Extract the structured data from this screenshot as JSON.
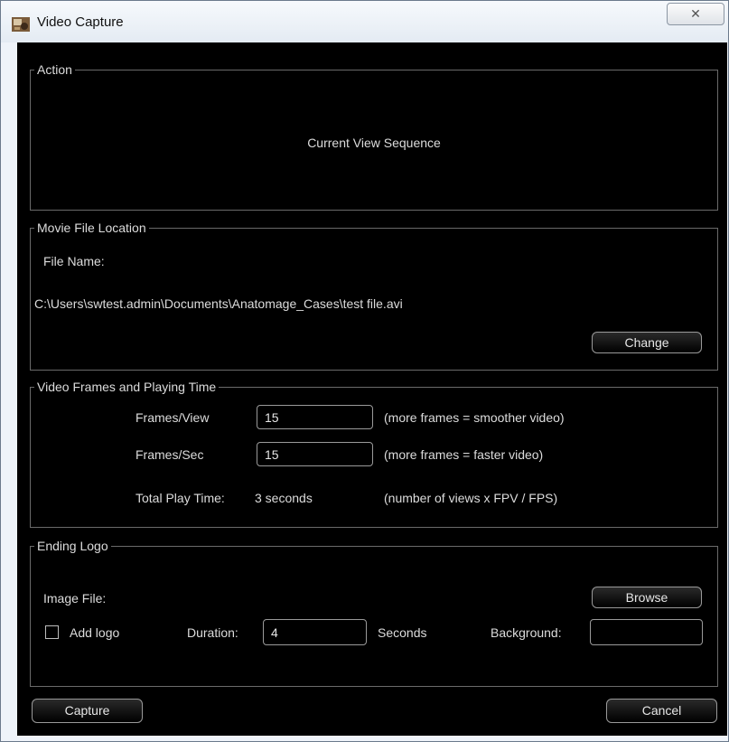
{
  "window": {
    "title": "Video Capture",
    "close_glyph": "✕",
    "app_icon": "video-camera-icon"
  },
  "action": {
    "legend": "Action",
    "value": "Current View Sequence"
  },
  "movie": {
    "legend": "Movie File Location",
    "file_name_label": "File Name:",
    "path": "C:\\Users\\swtest.admin\\Documents\\Anatomage_Cases\\test file.avi",
    "change_label": "Change"
  },
  "frames": {
    "legend": "Video Frames and Playing Time",
    "frames_view_label": "Frames/View",
    "frames_view_value": "15",
    "frames_view_hint": "(more frames = smoother video)",
    "frames_sec_label": "Frames/Sec",
    "frames_sec_value": "15",
    "frames_sec_hint": "(more frames = faster video)",
    "total_label": "Total Play Time:",
    "total_value": "3 seconds",
    "total_hint": "(number of views x FPV / FPS)"
  },
  "logo": {
    "legend": "Ending Logo",
    "image_file_label": "Image File:",
    "browse_label": "Browse",
    "add_logo_label": "Add logo",
    "duration_label": "Duration:",
    "duration_value": "4",
    "seconds_label": "Seconds",
    "background_label": "Background:",
    "background_value": ""
  },
  "footer": {
    "capture_label": "Capture",
    "cancel_label": "Cancel"
  }
}
